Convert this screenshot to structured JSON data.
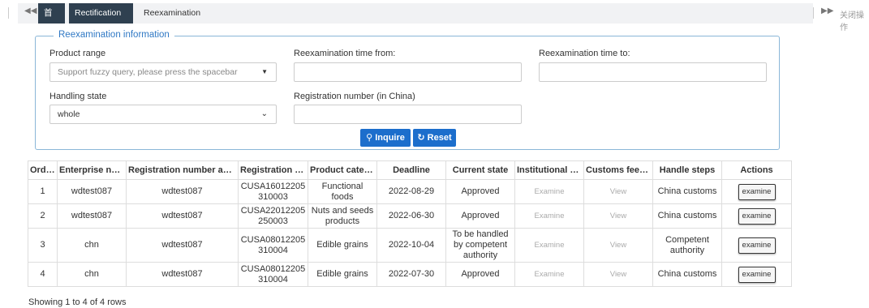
{
  "tabs": {
    "home": "首页",
    "rectification": "Rectification",
    "reexamination": "Reexamination",
    "close_ops": "关闭操作"
  },
  "form": {
    "legend": "Reexamination information",
    "product_range_label": "Product range",
    "product_range_placeholder": "Support fuzzy query, please press the spacebar",
    "time_from_label": "Reexamination time from:",
    "time_to_label": "Reexamination time to:",
    "handling_state_label": "Handling state",
    "handling_state_value": "whole",
    "registration_number_label": "Registration number (in China)",
    "inquire_label": "Inquire",
    "reset_label": "Reset"
  },
  "table": {
    "headers": [
      "Orde...",
      "Enterprise name",
      "Registration number appr...",
      "Registration nu...",
      "Product catego...",
      "Deadline",
      "Current state",
      "Institutional fe...",
      "Customs feedb...",
      "Handle steps",
      "Actions"
    ],
    "rows": [
      [
        "1",
        "wdtest087",
        "wdtest087",
        "CUSA16012205310003",
        "Functional foods",
        "2022-08-29",
        "Approved",
        "Examine",
        "View",
        "China customs",
        "examine"
      ],
      [
        "2",
        "wdtest087",
        "wdtest087",
        "CUSA22012205250003",
        "Nuts and seeds products",
        "2022-06-30",
        "Approved",
        "Examine",
        "View",
        "China customs",
        "examine"
      ],
      [
        "3",
        "chn",
        "wdtest087",
        "CUSA08012205310004",
        "Edible grains",
        "2022-10-04",
        "To be handled by competent authority",
        "Examine",
        "View",
        "Competent authority",
        "examine"
      ],
      [
        "4",
        "chn",
        "wdtest087",
        "CUSA08012205310004",
        "Edible grains",
        "2022-07-30",
        "Approved",
        "Examine",
        "View",
        "China customs",
        "examine"
      ]
    ]
  },
  "footer": {
    "pagination_text": "Showing 1 to 4 of 4 rows"
  }
}
